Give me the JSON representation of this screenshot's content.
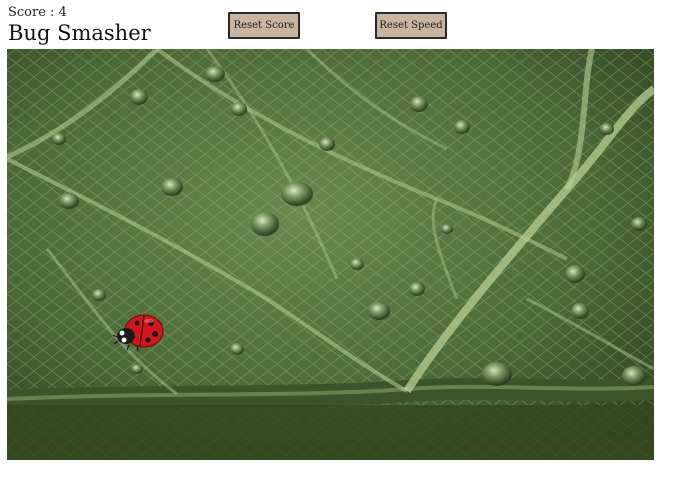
{
  "header": {
    "score_label": "Score : ",
    "score": 4,
    "title": "Bug Smasher"
  },
  "buttons": {
    "reset_score": "Reset Score",
    "reset_speed": "Reset Speed"
  },
  "board": {
    "background": "leaf-with-water-droplets",
    "bug": "ladybug-icon"
  },
  "colors": {
    "leaf_dark": "#2f4322",
    "leaf_mid": "#56733f",
    "vein": "#b9cf96",
    "ladybug_red": "#d3161b",
    "button_bg": "#c9b4a2"
  }
}
